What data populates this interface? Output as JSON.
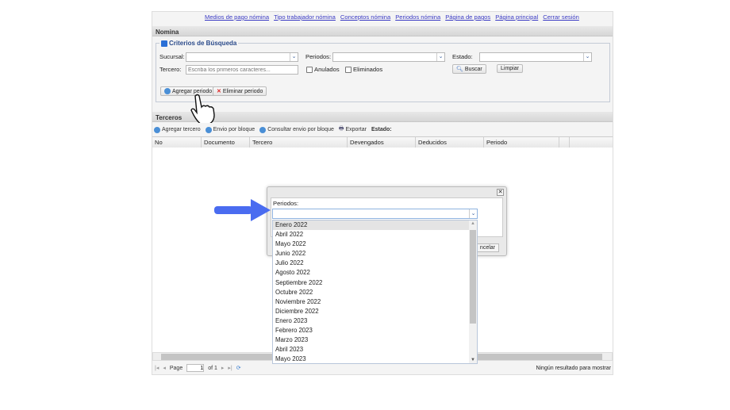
{
  "nav_links": [
    "Medios de pago nómina",
    "Tipo trabajador nómina",
    "Conceptos nómina",
    "Periodos nómina",
    "Página de pagos",
    "Página principal",
    "Cerrar sesión"
  ],
  "nomina": {
    "title": "Nomina",
    "criteria_title": "Criterios de Búsqueda",
    "sucursal_label": "Sucursal:",
    "periodos_label": "Periodos:",
    "estado_label": "Estado:",
    "tercero_label": "Tercero:",
    "tercero_placeholder": "Escriba los primeros caracteres...",
    "anulados": "Anulados",
    "eliminados": "Eliminados",
    "buscar": "Buscar",
    "limpiar": "Limpiar",
    "agregar_periodo": "Agregar periodo",
    "eliminar_periodo": "Eliminar periodo"
  },
  "terceros": {
    "title": "Terceros",
    "toolbar": [
      "Agregar tercero",
      "Envio por bloque",
      "Consultar envio por bloque",
      "Exportar"
    ],
    "estado_label": "Estado:",
    "columns": [
      "No",
      "Documento",
      "Tercero",
      "Devengados",
      "Deducidos",
      "Periodo"
    ],
    "paging": {
      "page_label": "Page",
      "page": "1",
      "of": "of 1",
      "status": "Ningún resultado para mostrar"
    }
  },
  "dialog": {
    "periodos_label": "Periodos:",
    "cancel_partial": "ncelar",
    "options": [
      "Enero 2022",
      "Abril 2022",
      "Mayo 2022",
      "Junio 2022",
      "Julio 2022",
      "Agosto 2022",
      "Septiembre 2022",
      "Octubre 2022",
      "Noviembre 2022",
      "Diciembre 2022",
      "Enero 2023",
      "Febrero 2023",
      "Marzo 2023",
      "Abril 2023",
      "Mayo 2023"
    ]
  },
  "colors": {
    "accent": "#4a6cf0",
    "link": "#3b3bc4"
  }
}
